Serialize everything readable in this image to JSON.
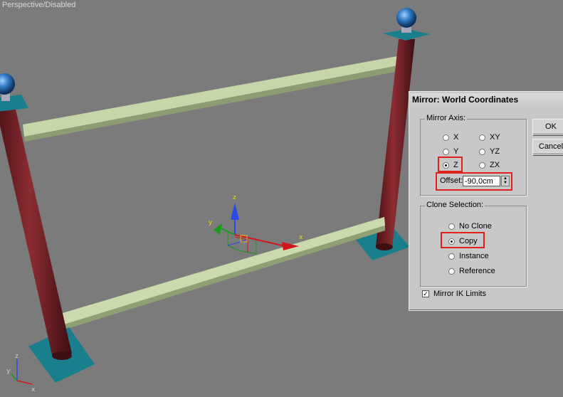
{
  "viewport": {
    "label": "Perspective/Disabled",
    "gizmo_axes": {
      "x": "x",
      "y": "y",
      "z": "z"
    },
    "corner_axes": {
      "x": "x",
      "y": "y",
      "z": "z"
    }
  },
  "dialog": {
    "title": "Mirror: World Coordinates",
    "mirror_axis": {
      "title": "Mirror Axis:",
      "options": [
        "X",
        "Y",
        "Z",
        "XY",
        "YZ",
        "ZX"
      ],
      "selected": "Z",
      "offset_label": "Offset:",
      "offset_value": "-90,0cm"
    },
    "clone_selection": {
      "title": "Clone Selection:",
      "options": [
        "No Clone",
        "Copy",
        "Instance",
        "Reference"
      ],
      "selected": "Copy"
    },
    "mirror_ik": {
      "label": "Mirror IK Limits",
      "checked": true
    },
    "buttons": {
      "ok": "OK",
      "cancel": "Cancel"
    }
  },
  "colors": {
    "post": "#7a2428",
    "base": "#1a7f8c",
    "rail": "#b6c69a",
    "sphere": "#3a7ac0",
    "highlight": "#e0201c"
  }
}
